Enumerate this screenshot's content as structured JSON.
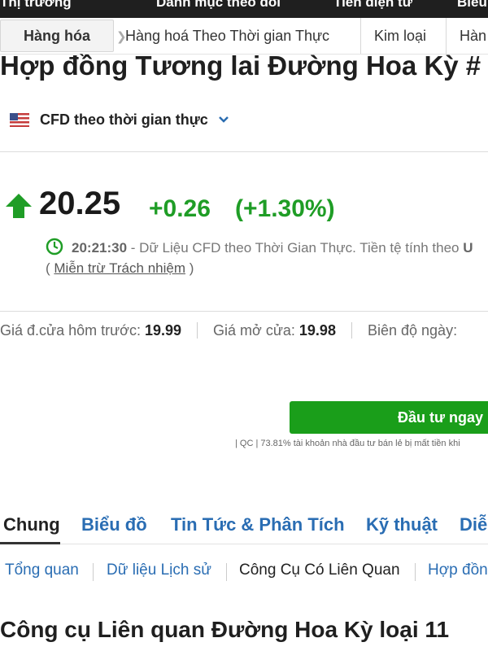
{
  "top_nav": [
    "Thị trường",
    "Danh mục theo dõi",
    "Tiền điện tử",
    "Biểu"
  ],
  "breadcrumbs": {
    "active": "Hàng hóa",
    "items": [
      "Hàng hoá Theo Thời gian Thực",
      "Kim loại",
      "Hàn"
    ]
  },
  "title": "Hợp đồng Tương lai Đường Hoa Kỳ #",
  "cfd": {
    "label": "CFD theo thời gian thực",
    "flag_icon": "us-flag-icon"
  },
  "quote": {
    "price": "20.25",
    "change": "+0.26",
    "change_pct": "(+1.30%)",
    "up_color": "#1f9d26"
  },
  "time_info": {
    "time": "20:21:30",
    "text": " - Dữ Liệu CFD theo Thời Gian Thực. Tiền tệ tính theo ",
    "currency": "U"
  },
  "disclaimer": {
    "open": "( ",
    "link": "Miễn trừ Trách nhiệm",
    "close": " )"
  },
  "stats": {
    "prev_close_label": "Giá đ.cửa hôm trước: ",
    "prev_close": "19.99",
    "open_label": "Giá mở cửa: ",
    "open": "19.98",
    "range_label": "Biên độ ngày:"
  },
  "invest_button": "Đầu tư ngay",
  "ad_note": "| QC | 73.81% tài khoản nhà đầu tư bán lẻ bị mất tiền khi",
  "tabs": [
    "Chung",
    "Biểu đồ",
    "Tin Tức & Phân Tích",
    "Kỹ thuật",
    "Diễ"
  ],
  "subtabs": [
    "Tổng quan",
    "Dữ liệu Lịch sử",
    "Công Cụ Có Liên Quan",
    "Hợp đồn"
  ],
  "section_title": "Công cụ Liên quan Đường Hoa Kỳ loại 11"
}
